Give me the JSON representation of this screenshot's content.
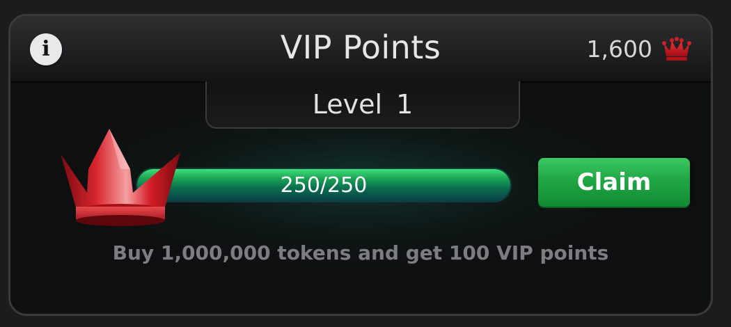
{
  "header": {
    "info_icon": "info-icon",
    "info_glyph": "i",
    "title": "VIP Points",
    "points_value": "1,600",
    "points_icon": "crown-icon"
  },
  "level": {
    "label": "Level  1"
  },
  "progress": {
    "label": "250/250",
    "current": 250,
    "max": 250,
    "fraction": 1.0
  },
  "claim_button": {
    "label": "Claim"
  },
  "description": "Buy 1,000,000 tokens and get 100 VIP points",
  "colors": {
    "crown_red": "#c8101a",
    "progress_green": "#1ba354",
    "claim_green": "#1fa744",
    "panel_bg": "#0e0f10"
  },
  "decor": {
    "big_crown_icon": "crown-icon"
  }
}
